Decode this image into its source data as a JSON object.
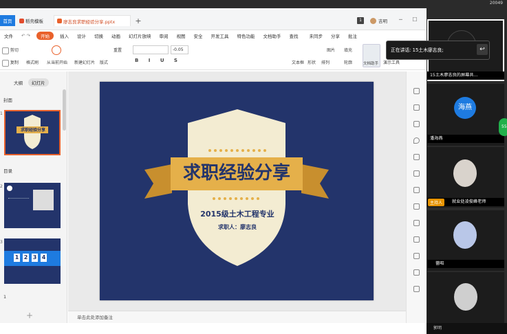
{
  "system": {
    "clock": "20049"
  },
  "tabs": {
    "home": "首页",
    "template": "稻壳模板",
    "document": "廖志良求职经验分享.pptx"
  },
  "titlebar": {
    "counter": "1",
    "user": "吉明"
  },
  "ribbon": {
    "file": "文件",
    "menus": [
      "开始",
      "插入",
      "设计",
      "切换",
      "动画",
      "幻灯片放映",
      "审阅",
      "视图",
      "安全",
      "开发工具",
      "特色功能",
      "文档助手",
      "查找"
    ],
    "right": [
      "未同步",
      "分享",
      "批注"
    ],
    "tools": {
      "cut": "剪切",
      "copy": "复制",
      "format_painter": "格式刷",
      "from_start": "从当前开始",
      "new_slide": "新建幻灯片",
      "layout": "版式",
      "reset": "重置",
      "font_size": "-0.05",
      "textbox": "文本框",
      "shape": "形状",
      "arrange": "排列",
      "picture": "图片",
      "fill": "填充",
      "outline": "轮廓",
      "doc_assist": "文档助手",
      "present": "演示工具"
    }
  },
  "left_panel": {
    "tabs": [
      "大纲",
      "幻灯片"
    ],
    "sections": [
      "封面",
      "目录",
      "1"
    ],
    "slide_numbers": [
      "1",
      "2",
      "3"
    ],
    "thumb1_title": "求职经验分享",
    "thumb3_digits": [
      "1",
      "2",
      "3",
      "4"
    ]
  },
  "slide": {
    "title": "求职经验分享",
    "subtitle": "2015级土木工程专业",
    "presenter": "求职人：廖志良",
    "colors": {
      "bg": "#23346b",
      "shield": "#f3ecd2",
      "banner": "#e5b04a",
      "text": "#23346b"
    }
  },
  "notes": {
    "placeholder": "单击此处添加备注"
  },
  "meeting": {
    "speaking": "正在讲话: 15土木廖志良;",
    "participants": [
      {
        "name": "15土木廖志良的屏幕共...",
        "avatar_text": ""
      },
      {
        "name": "潘海燕",
        "avatar_text": "海燕"
      },
      {
        "name": "就业处凌俊峰老师",
        "host": "主持人"
      },
      {
        "name": "蔷昭"
      },
      {
        "name": "郭明"
      }
    ]
  }
}
